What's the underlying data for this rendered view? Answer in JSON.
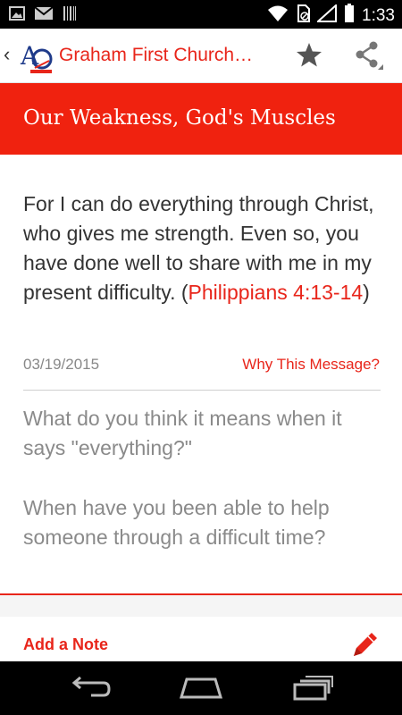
{
  "status_bar": {
    "time": "1:33",
    "icons": [
      "image-icon",
      "mail-icon",
      "barcode-icon",
      "wifi-icon",
      "no-sim-icon",
      "signal-icon",
      "battery-icon"
    ]
  },
  "action_bar": {
    "title": "Graham First Church…",
    "icons": [
      "back-chevron-icon",
      "app-logo-icon",
      "star-icon",
      "share-icon"
    ]
  },
  "message": {
    "title": "Our Weakness, God's Muscles",
    "verse_text": "For I can do everything through Christ, who gives me strength. Even so, you have done well to share with me in my present difficulty.",
    "verse_ref_open": "(",
    "verse_ref": "Philippians 4:13-14",
    "verse_ref_close": ")",
    "date": "03/19/2015",
    "why_link": "Why This Message?"
  },
  "questions": [
    "What do you think it means when it says \"everything?\"",
    "When have you been able to help someone through a difficult time?"
  ],
  "note_bar": {
    "label": "Add a Note",
    "icon": "pencil-icon"
  },
  "nav_bar": {
    "icons": [
      "back-icon",
      "home-icon",
      "recent-apps-icon"
    ]
  },
  "colors": {
    "accent": "#e8251a",
    "banner": "#f0220f",
    "verse_text": "#333333",
    "question_text": "#8a8a8a",
    "date_text": "#888888"
  }
}
